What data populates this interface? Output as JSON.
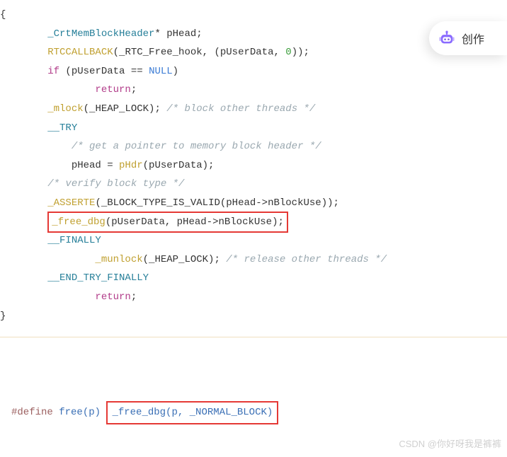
{
  "code": {
    "l1": "{",
    "l2_indent": "        ",
    "l2_type": "_CrtMemBlockHeader",
    "l2_rest": "* pHead;",
    "l3_indent": "        ",
    "l3_call": "RTCCALLBACK",
    "l3_rest1": "(_RTC_Free_hook, (pUserData, ",
    "l3_num": "0",
    "l3_rest2": "));",
    "l4_indent": "        ",
    "l4_kw": "if",
    "l4_rest1": " (pUserData == ",
    "l4_null": "NULL",
    "l4_rest2": ")",
    "l5_indent": "                ",
    "l5_kw": "return",
    "l5_rest": ";",
    "l6_indent": "        ",
    "l6_call": "_mlock",
    "l6_rest": "(_HEAP_LOCK); ",
    "l6_comment": "/* block other threads */",
    "l7_indent": "        ",
    "l7_try": "__TRY",
    "l8_indent": "            ",
    "l8_comment": "/* get a pointer to memory block header */",
    "l9_indent": "            pHead = ",
    "l9_call": "pHdr",
    "l9_rest": "(pUserData);",
    "l10_indent": "        ",
    "l10_comment": "/* verify block type */",
    "l11_indent": "        ",
    "l11_call": "_ASSERTE",
    "l11_rest": "(_BLOCK_TYPE_IS_VALID(pHead->nBlockUse));",
    "l12_indent": "        ",
    "l12_box_call": "_free_dbg",
    "l12_box_rest": "(pUserData, pHead->nBlockUse);",
    "l13_indent": "        ",
    "l13_finally": "__FINALLY",
    "l14_indent": "                ",
    "l14_call": "_munlock",
    "l14_rest": "(_HEAP_LOCK); ",
    "l14_comment": "/* release other threads */",
    "l15_indent": "        ",
    "l15_end": "__END_TRY_FINALLY",
    "l16_indent": "                ",
    "l16_kw": "return",
    "l16_rest": ";",
    "l17": "}"
  },
  "bottom": {
    "define": "#define",
    "free": " free(p) ",
    "box_call": "_free_dbg(p, _NORMAL_BLOCK)"
  },
  "button": {
    "label": "创作"
  },
  "watermark": "CSDN @你好呀我是裤裤"
}
